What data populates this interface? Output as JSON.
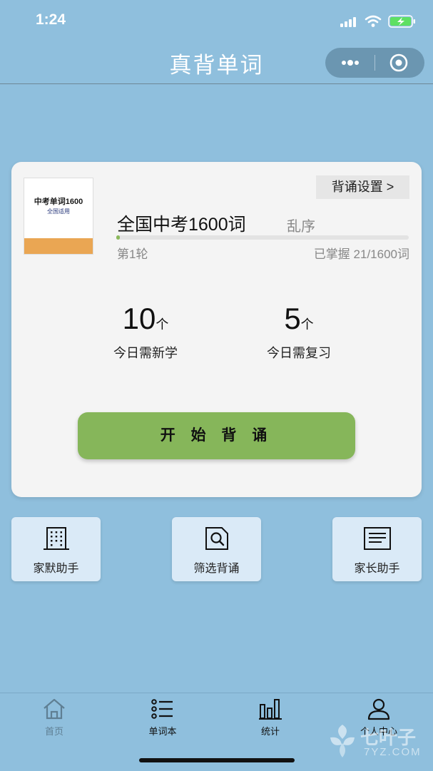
{
  "status": {
    "time": "1:24"
  },
  "nav": {
    "title": "真背单词"
  },
  "book": {
    "cover_title": "中考单词1600",
    "cover_subtitle": "全国适用",
    "name": "全国中考1600词",
    "order": "乱序",
    "settings_label": "背诵设置 >",
    "round": "第1轮",
    "mastered": "已掌握 21/1600词",
    "progress_fraction": 0.013
  },
  "stats": {
    "new": {
      "value": "10",
      "unit": "个",
      "label": "今日需新学"
    },
    "review": {
      "value": "5",
      "unit": "个",
      "label": "今日需复习"
    }
  },
  "start_label": "开 始 背 诵",
  "tools": [
    {
      "label": "家默助手",
      "icon": "building-icon"
    },
    {
      "label": "筛选背诵",
      "icon": "search-document-icon"
    },
    {
      "label": "家长助手",
      "icon": "document-lines-icon"
    }
  ],
  "tabs": [
    {
      "label": "首页",
      "icon": "home-icon",
      "color": "#5f7f93"
    },
    {
      "label": "单词本",
      "icon": "list-icon",
      "color": "#111111"
    },
    {
      "label": "统计",
      "icon": "bar-chart-icon",
      "color": "#111111"
    },
    {
      "label": "个人中心",
      "icon": "user-icon",
      "color": "#111111"
    }
  ],
  "watermark": {
    "brand": "七叶子",
    "url": "7YZ.COM"
  },
  "colors": {
    "background": "#8fbfdd",
    "accent_green": "#86b65a",
    "tool_bg": "#daeaf7",
    "book_band": "#eaa653"
  }
}
